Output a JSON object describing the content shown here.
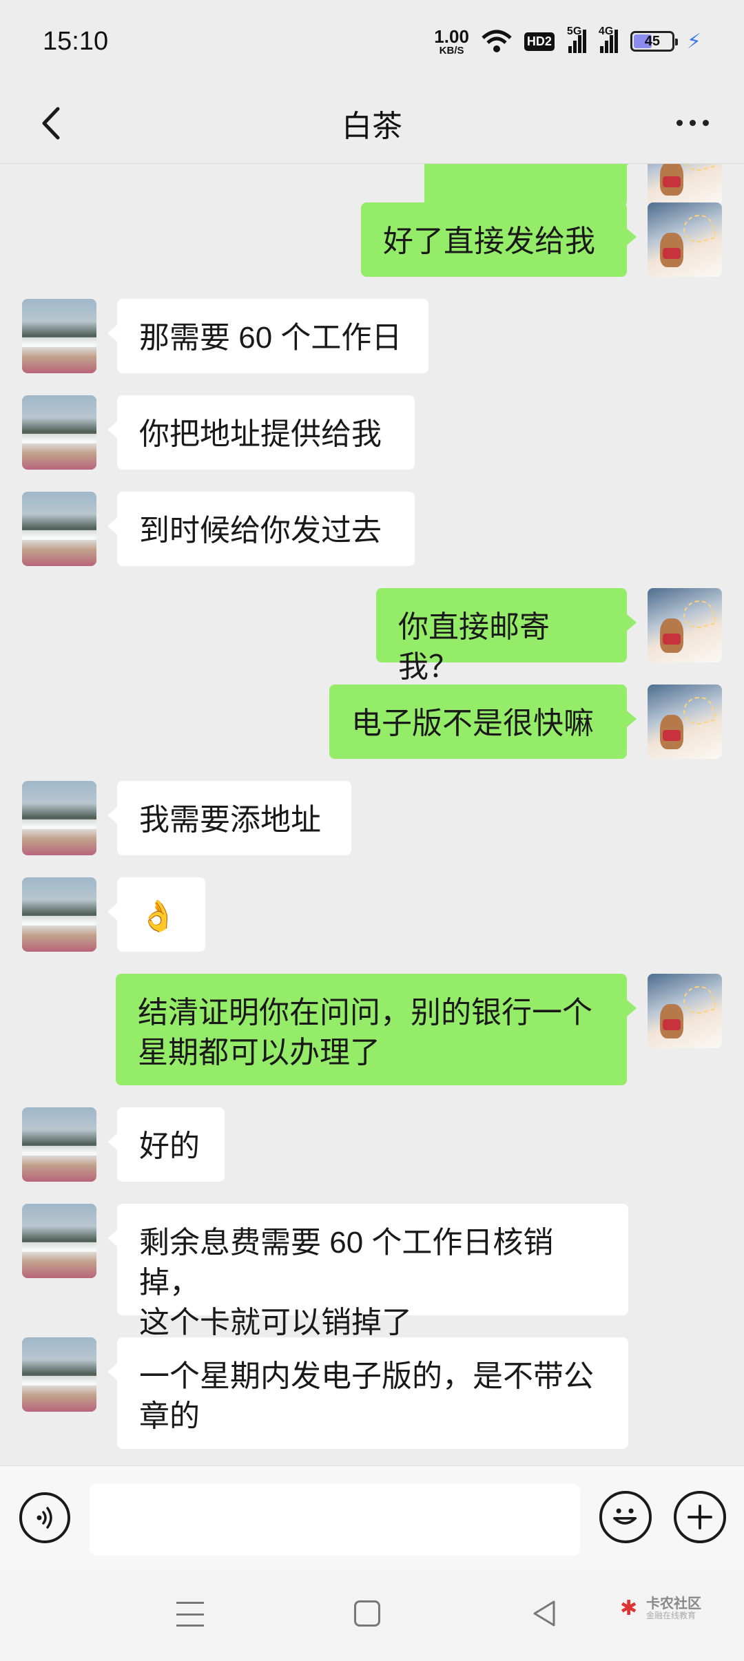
{
  "status_bar": {
    "time": "15:10",
    "net_speed_value": "1.00",
    "net_speed_unit": "KB/S",
    "hd_label": "HD2",
    "sig1_label": "5G",
    "sig2_label": "4G",
    "battery": "45"
  },
  "header": {
    "title": "白茶"
  },
  "messages": [
    {
      "side": "right",
      "text": ""
    },
    {
      "side": "right",
      "text": "好了直接发给我"
    },
    {
      "side": "left",
      "text": "那需要 60 个工作日"
    },
    {
      "side": "left",
      "text": "你把地址提供给我"
    },
    {
      "side": "left",
      "text": "到时候给你发过去"
    },
    {
      "side": "right",
      "text": "你直接邮寄我？"
    },
    {
      "side": "right",
      "text": "电子版不是很快嘛"
    },
    {
      "side": "left",
      "text": "我需要添地址"
    },
    {
      "side": "left",
      "text": "👌"
    },
    {
      "side": "right",
      "text": "结清证明你在问问，别的银行一个\n星期都可以办理了"
    },
    {
      "side": "left",
      "text": "好的"
    },
    {
      "side": "left",
      "text": "剩余息费需要 60 个工作日核销掉，\n这个卡就可以销掉了"
    },
    {
      "side": "left",
      "text": "一个星期内发电子版的，是不带公\n章的"
    }
  ],
  "input_bar": {
    "placeholder": ""
  },
  "watermark": {
    "title": "卡农社区",
    "subtitle": "金融在线教育"
  },
  "colors": {
    "sent_bubble": "#95ec69",
    "received_bubble": "#ffffff",
    "background": "#ededed"
  }
}
